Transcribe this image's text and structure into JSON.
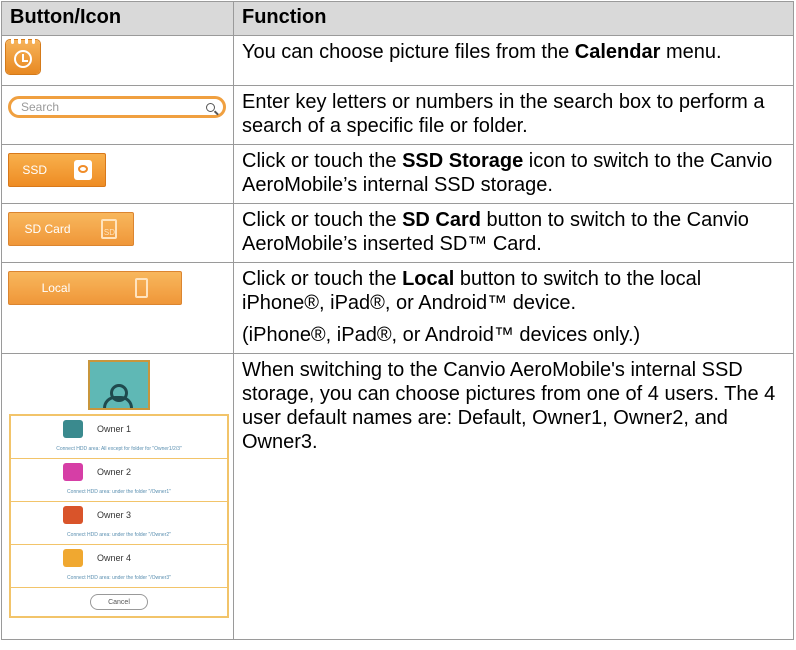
{
  "header": {
    "col1": "Button/Icon",
    "col2": "Function"
  },
  "rows": {
    "calendar": {
      "pre": "You can choose picture files from the ",
      "bold": "Calendar",
      "post": " menu."
    },
    "search": {
      "placeholder": "Search",
      "text": "Enter key letters or numbers in the search box to perform a search of a specific file or folder."
    },
    "ssd": {
      "button_label": "SSD",
      "pre": "Click or touch the ",
      "bold": "SSD Storage",
      "post": " icon to switch to the Canvio AeroMobile’s internal SSD storage."
    },
    "sdcard": {
      "button_label": "SD Card",
      "card_glyph": "SD",
      "pre": "Click or touch the ",
      "bold": "SD Card",
      "post": " button to switch to the Canvio AeroMobile’s inserted SD™ Card."
    },
    "local": {
      "button_label": "Local",
      "pre": "Click or touch the ",
      "bold": "Local",
      "post": " button to switch to the local iPhone®, iPad®, or Android™ device.",
      "note": "(iPhone®, iPad®, or Android™ devices only.)"
    },
    "users": {
      "text": "When switching to the Canvio AeroMobile's internal SSD storage, you can choose pictures from one of 4 users. The 4 user default names are: Default, Owner1, Owner2, and Owner3.",
      "owners": [
        {
          "name": "Owner 1",
          "sub": "Connect HDD area: All except for folder for \"Owner1/2/3\"",
          "color": "#3a8a8e"
        },
        {
          "name": "Owner 2",
          "sub": "Connect HDD area: under the folder \"/Owner1\"",
          "color": "#d63ea6"
        },
        {
          "name": "Owner 3",
          "sub": "Connect HDD area: under the folder \"/Owner2\"",
          "color": "#d9542a"
        },
        {
          "name": "Owner 4",
          "sub": "Connect HDD area: under the folder \"/Owner3\"",
          "color": "#f0a830"
        }
      ],
      "cancel_label": "Cancel"
    }
  }
}
